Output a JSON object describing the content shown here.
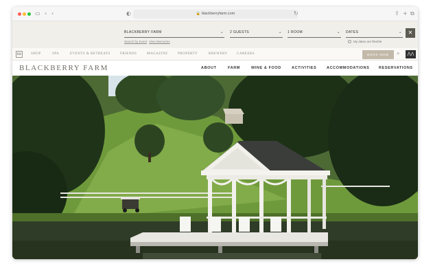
{
  "browser": {
    "url": "blackberryfarm.com"
  },
  "booking": {
    "location": "BLACKBERRY FARM",
    "guests": "2 GUESTS",
    "rooms": "1 ROOM",
    "dates": "DATES",
    "search_events": "Search by Event",
    "view_memories": "View Memories",
    "flexible_dates": "My dates are flexible"
  },
  "utility_nav": {
    "items": [
      "SHOP",
      "SPA",
      "EVENTS & RETREATS",
      "FRIENDS",
      "MAGAZINE",
      "PROPERTY",
      "BREWERY",
      "CAREERS"
    ],
    "book_now": "BOOK NOW"
  },
  "main_nav": {
    "logo": "BLACKBERRY FARM",
    "items": [
      "ABOUT",
      "FARM",
      "WINE & FOOD",
      "ACTIVITIES",
      "ACCOMMODATIONS",
      "RESERVATIONS"
    ]
  },
  "colors": {
    "booking_bg": "#f1efea",
    "book_button": "#c2b9a8",
    "dark_button": "#5d5a50"
  }
}
